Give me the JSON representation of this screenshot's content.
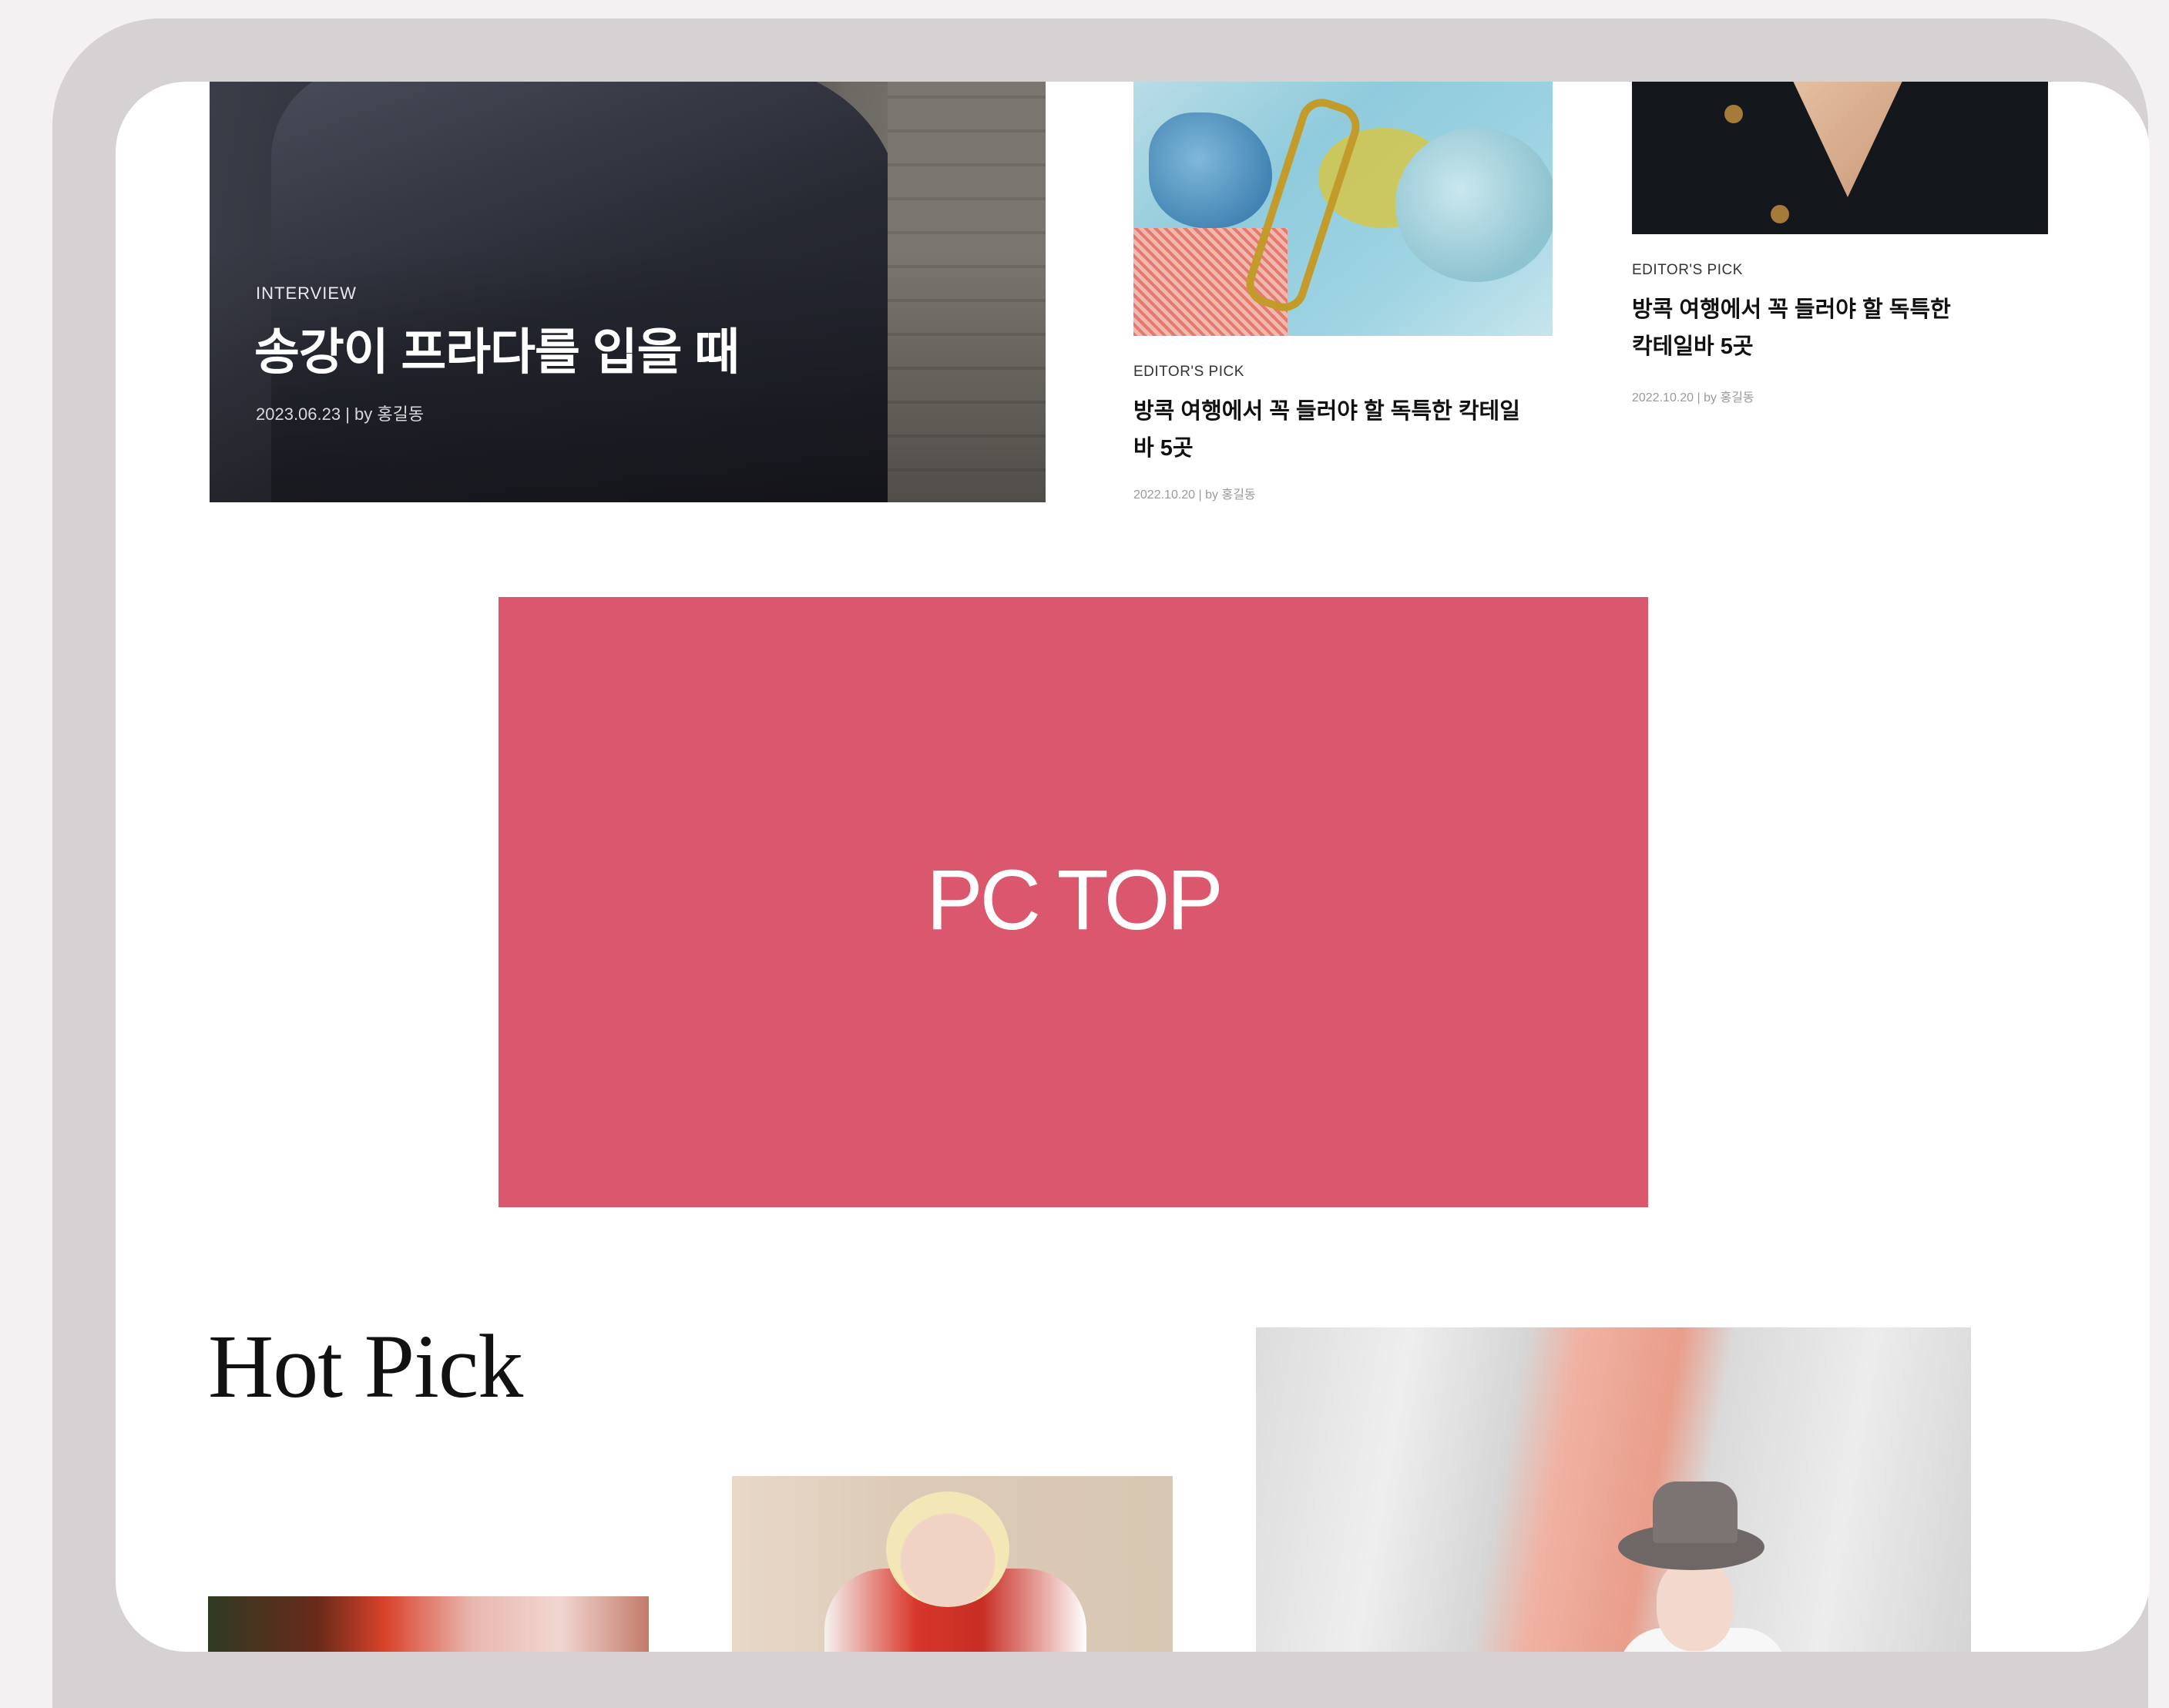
{
  "feature": {
    "category": "INTERVIEW",
    "title": "송강이 프라다를 입을 때",
    "meta": "2023.06.23 | by 홍길동"
  },
  "cards": [
    {
      "category": "EDITOR'S PICK",
      "title_line1": "방콕 여행에서 꼭 들러야 할 독특한 칵테일",
      "title_line2": "바 5곳",
      "meta": "2022.10.20 | by 홍길동"
    },
    {
      "category": "EDITOR'S PICK",
      "title_line1": "방콕 여행에서 꼭 들러야 할 독특한",
      "title_line2": "칵테일바 5곳",
      "meta": "2022.10.20 | by 홍길동"
    }
  ],
  "ad": {
    "label": "PC TOP",
    "color": "#db576d"
  },
  "hot_pick": {
    "title": "Hot Pick"
  }
}
